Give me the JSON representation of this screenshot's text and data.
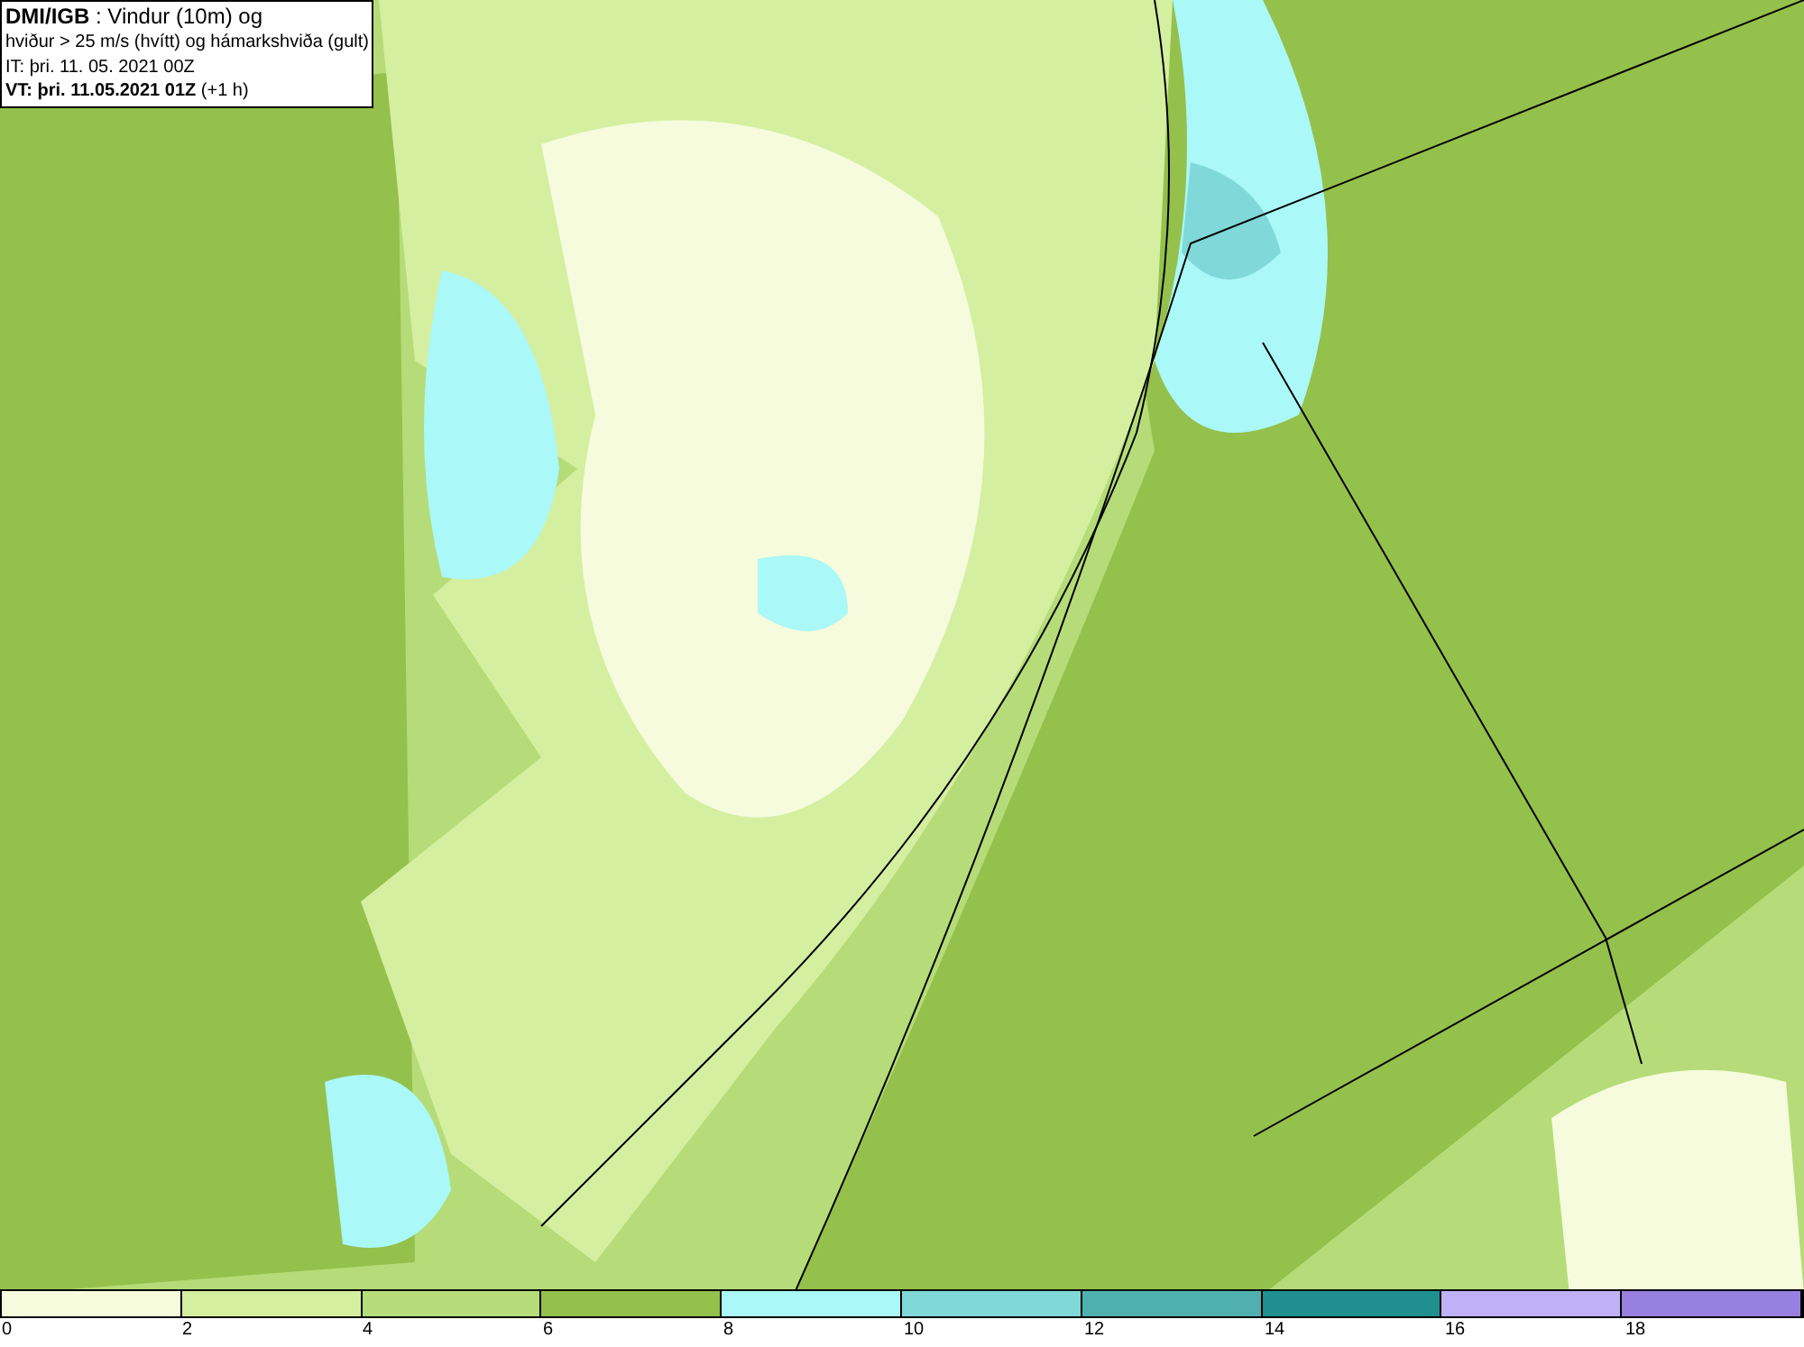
{
  "title_box": {
    "lines": [
      "**DMI/IGB** : Vindur (10m) og",
      "hviður > 25 m/s (hvítt) og hámarkshviða (gult)",
      "IT: þri. 11. 05. 2021 00Z",
      "**VT: þri. 11.05.2021 01Z** (+1 h)"
    ]
  },
  "legend": {
    "segments": [
      {
        "color": "#f5fbdc"
      },
      {
        "color": "#d4efa0"
      },
      {
        "color": "#b5dc78"
      },
      {
        "color": "#94c04c"
      },
      {
        "color": "#aaf8f8"
      },
      {
        "color": "#80d8d8"
      },
      {
        "color": "#50b0b0"
      },
      {
        "color": "#208f8f"
      },
      {
        "color": "#c0b0f8"
      },
      {
        "color": "#9880e0"
      }
    ],
    "labels": [
      "0",
      "2",
      "4",
      "6",
      "8",
      "10",
      "12",
      "14",
      "16",
      "18"
    ]
  }
}
